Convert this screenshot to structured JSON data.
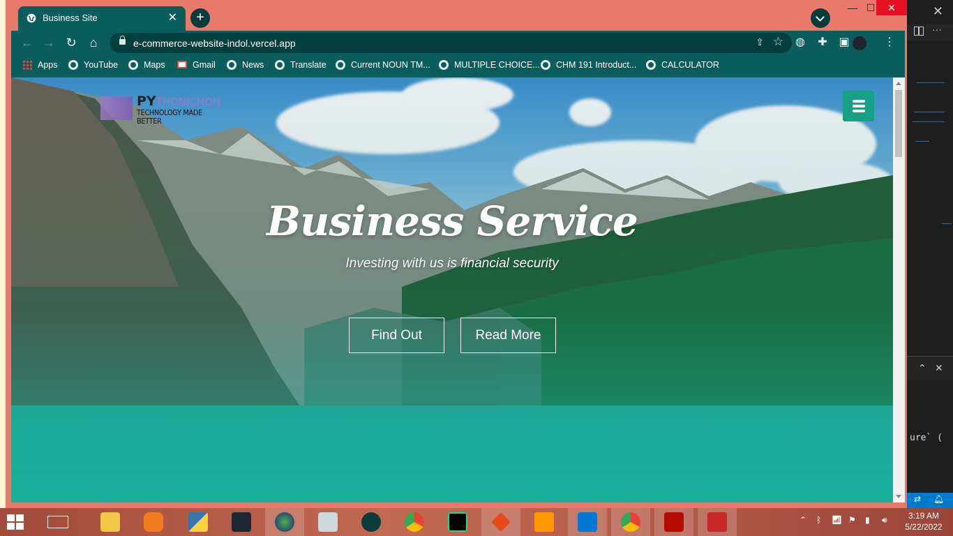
{
  "browser": {
    "tab_title": "Business Site",
    "url": "e-commerce-website-indol.vercel.app",
    "new_tab_label": "+",
    "window_controls": {
      "minimize": "—",
      "maximize": "☐",
      "close": "✕"
    }
  },
  "bookmarks": [
    {
      "label": "Apps",
      "icon": "apps-grid-icon"
    },
    {
      "label": "YouTube",
      "icon": "globe-icon"
    },
    {
      "label": "Maps",
      "icon": "globe-icon"
    },
    {
      "label": "Gmail",
      "icon": "gmail-icon"
    },
    {
      "label": "News",
      "icon": "globe-icon"
    },
    {
      "label": "Translate",
      "icon": "globe-icon"
    },
    {
      "label": "Current NOUN TM...",
      "icon": "globe-icon"
    },
    {
      "label": "MULTIPLE CHOICE...",
      "icon": "globe-icon"
    },
    {
      "label": "CHM 191 Introduct...",
      "icon": "globe-icon"
    },
    {
      "label": "CALCULATOR",
      "icon": "globe-icon"
    }
  ],
  "site": {
    "logo": {
      "mark": "PY",
      "name": "THONICHON",
      "tagline": "TECHNOLOGY MADE BETTER"
    },
    "hero_title": "Business Service",
    "hero_subtitle": "Investing with us is financial security",
    "buttons": {
      "find_out": "Find Out",
      "read_more": "Read More"
    },
    "accent_color": "#16a085"
  },
  "background_app": {
    "terminal_text": "ure` ("
  },
  "taskbar": {
    "time": "3:19 AM",
    "date": "5/22/2022"
  }
}
